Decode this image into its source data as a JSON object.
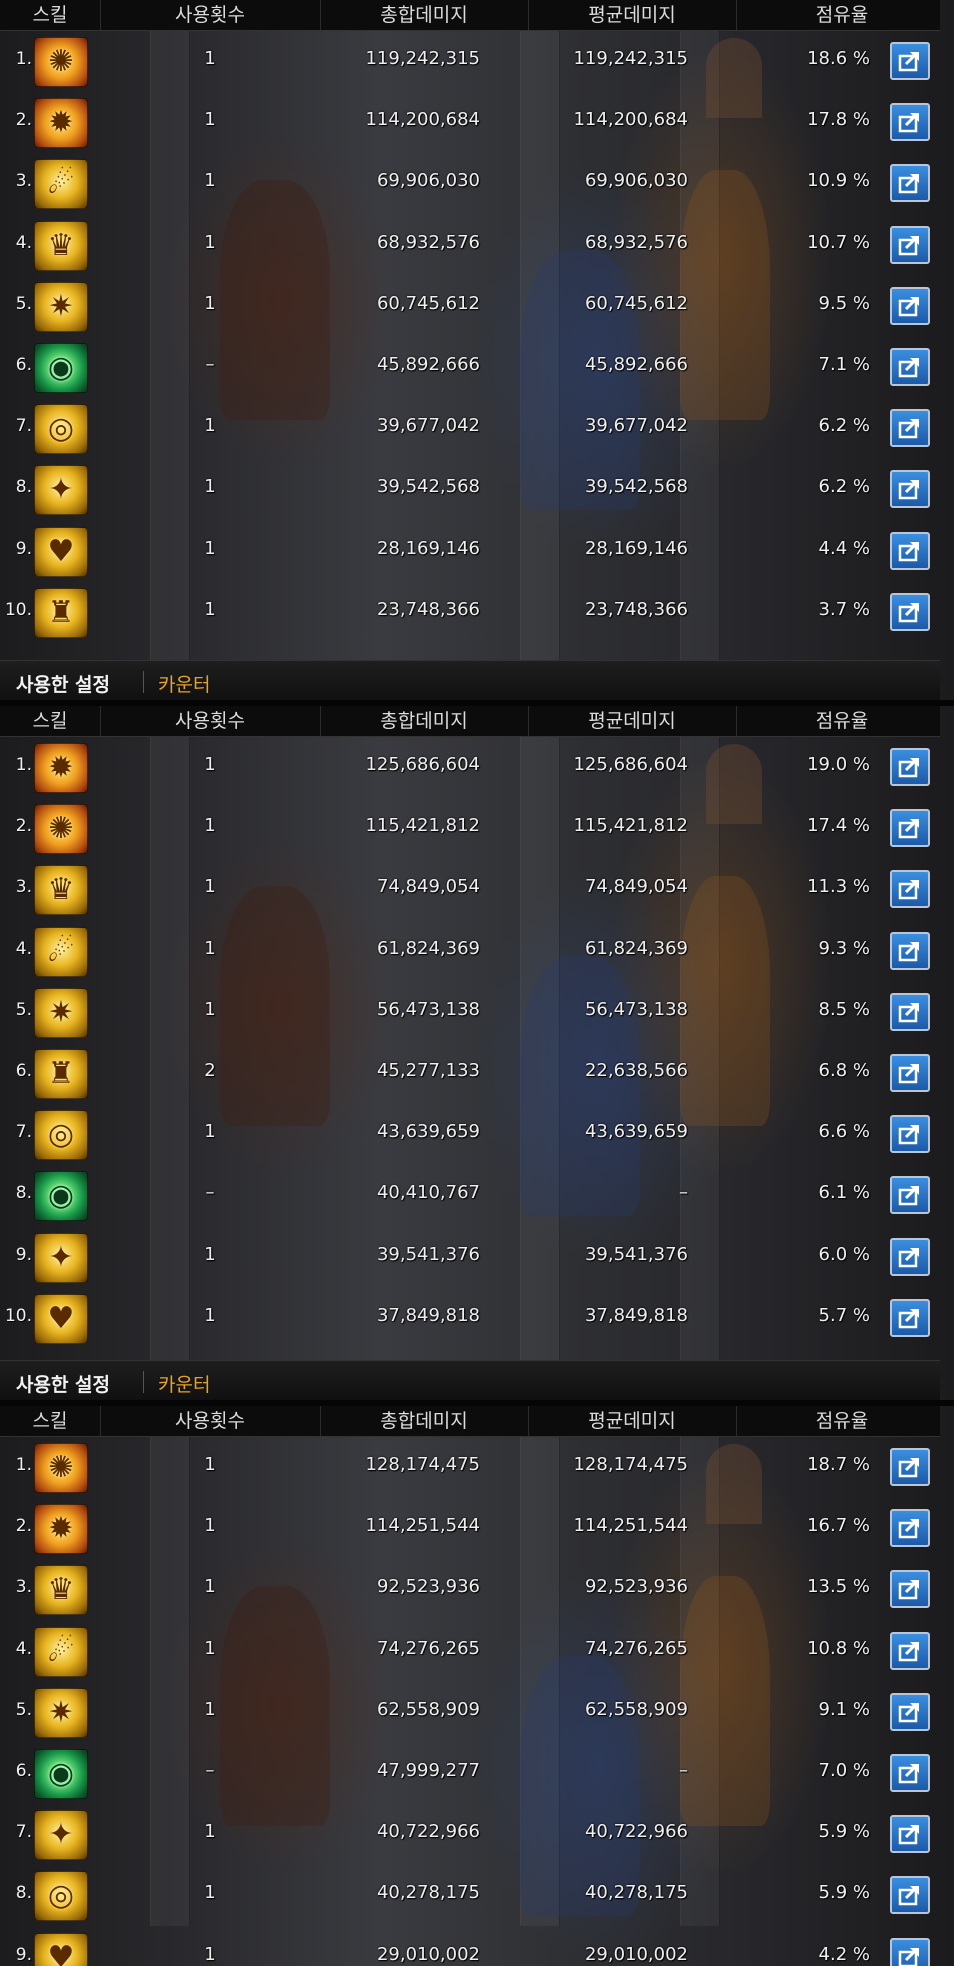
{
  "headers": {
    "skill": "스킬",
    "count": "사용횟수",
    "total": "총합데미지",
    "avg": "평균데미지",
    "share": "점유율"
  },
  "footer": {
    "used_settings": "사용한 설정",
    "counter": "카운터"
  },
  "colors": {
    "header_bg": "#0c0c0c",
    "counter_tab": "#e8a22a",
    "share_button": "#2a74c8"
  },
  "panels": [
    {
      "rows": [
        {
          "rank": "1.",
          "icon": "burst-skill-icon",
          "icon_style": "fire",
          "count": "1",
          "total": "119,242,315",
          "avg": "119,242,315",
          "share": "18.6 %"
        },
        {
          "rank": "2.",
          "icon": "flame-skill-icon",
          "icon_style": "fire",
          "count": "1",
          "total": "114,200,684",
          "avg": "114,200,684",
          "share": "17.8 %"
        },
        {
          "rank": "3.",
          "icon": "slash-skill-icon",
          "icon_style": "gold",
          "count": "1",
          "total": "69,906,030",
          "avg": "69,906,030",
          "share": "10.9 %"
        },
        {
          "rank": "4.",
          "icon": "crown-skill-icon",
          "icon_style": "gold",
          "count": "1",
          "total": "68,932,576",
          "avg": "68,932,576",
          "share": "10.7 %"
        },
        {
          "rank": "5.",
          "icon": "gear-skill-icon",
          "icon_style": "gold",
          "count": "1",
          "total": "60,745,612",
          "avg": "60,745,612",
          "share": "9.5 %"
        },
        {
          "rank": "6.",
          "icon": "eye-skill-icon",
          "icon_style": "green",
          "count": "–",
          "total": "45,892,666",
          "avg": "45,892,666",
          "share": "7.1 %"
        },
        {
          "rank": "7.",
          "icon": "ring-skill-icon",
          "icon_style": "gold",
          "count": "1",
          "total": "39,677,042",
          "avg": "39,677,042",
          "share": "6.2 %"
        },
        {
          "rank": "8.",
          "icon": "wing-skill-icon",
          "icon_style": "gold",
          "count": "1",
          "total": "39,542,568",
          "avg": "39,542,568",
          "share": "6.2 %"
        },
        {
          "rank": "9.",
          "icon": "heart-skill-icon",
          "icon_style": "gold",
          "count": "1",
          "total": "28,169,146",
          "avg": "28,169,146",
          "share": "4.4 %"
        },
        {
          "rank": "10.",
          "icon": "pillar-skill-icon",
          "icon_style": "gold",
          "count": "1",
          "total": "23,748,366",
          "avg": "23,748,366",
          "share": "3.7 %"
        }
      ]
    },
    {
      "rows": [
        {
          "rank": "1.",
          "icon": "flame-skill-icon",
          "icon_style": "fire",
          "count": "1",
          "total": "125,686,604",
          "avg": "125,686,604",
          "share": "19.0 %"
        },
        {
          "rank": "2.",
          "icon": "burst-skill-icon",
          "icon_style": "fire",
          "count": "1",
          "total": "115,421,812",
          "avg": "115,421,812",
          "share": "17.4 %"
        },
        {
          "rank": "3.",
          "icon": "crown-skill-icon",
          "icon_style": "gold",
          "count": "1",
          "total": "74,849,054",
          "avg": "74,849,054",
          "share": "11.3 %"
        },
        {
          "rank": "4.",
          "icon": "slash-skill-icon",
          "icon_style": "gold",
          "count": "1",
          "total": "61,824,369",
          "avg": "61,824,369",
          "share": "9.3 %"
        },
        {
          "rank": "5.",
          "icon": "gear-skill-icon",
          "icon_style": "gold",
          "count": "1",
          "total": "56,473,138",
          "avg": "56,473,138",
          "share": "8.5 %"
        },
        {
          "rank": "6.",
          "icon": "pillar-skill-icon",
          "icon_style": "gold",
          "count": "2",
          "total": "45,277,133",
          "avg": "22,638,566",
          "share": "6.8 %"
        },
        {
          "rank": "7.",
          "icon": "ring-skill-icon",
          "icon_style": "gold",
          "count": "1",
          "total": "43,639,659",
          "avg": "43,639,659",
          "share": "6.6 %"
        },
        {
          "rank": "8.",
          "icon": "eye-skill-icon",
          "icon_style": "green",
          "count": "–",
          "total": "40,410,767",
          "avg": "–",
          "share": "6.1 %"
        },
        {
          "rank": "9.",
          "icon": "wing-skill-icon",
          "icon_style": "gold",
          "count": "1",
          "total": "39,541,376",
          "avg": "39,541,376",
          "share": "6.0 %"
        },
        {
          "rank": "10.",
          "icon": "heart-skill-icon",
          "icon_style": "gold",
          "count": "1",
          "total": "37,849,818",
          "avg": "37,849,818",
          "share": "5.7 %"
        }
      ]
    },
    {
      "rows": [
        {
          "rank": "1.",
          "icon": "burst-skill-icon",
          "icon_style": "fire",
          "count": "1",
          "total": "128,174,475",
          "avg": "128,174,475",
          "share": "18.7 %"
        },
        {
          "rank": "2.",
          "icon": "flame-skill-icon",
          "icon_style": "fire",
          "count": "1",
          "total": "114,251,544",
          "avg": "114,251,544",
          "share": "16.7 %"
        },
        {
          "rank": "3.",
          "icon": "crown-skill-icon",
          "icon_style": "gold",
          "count": "1",
          "total": "92,523,936",
          "avg": "92,523,936",
          "share": "13.5 %"
        },
        {
          "rank": "4.",
          "icon": "slash-skill-icon",
          "icon_style": "gold",
          "count": "1",
          "total": "74,276,265",
          "avg": "74,276,265",
          "share": "10.8 %"
        },
        {
          "rank": "5.",
          "icon": "gear-skill-icon",
          "icon_style": "gold",
          "count": "1",
          "total": "62,558,909",
          "avg": "62,558,909",
          "share": "9.1 %"
        },
        {
          "rank": "6.",
          "icon": "eye-skill-icon",
          "icon_style": "green",
          "count": "–",
          "total": "47,999,277",
          "avg": "–",
          "share": "7.0 %"
        },
        {
          "rank": "7.",
          "icon": "wing-skill-icon",
          "icon_style": "gold",
          "count": "1",
          "total": "40,722,966",
          "avg": "40,722,966",
          "share": "5.9 %"
        },
        {
          "rank": "8.",
          "icon": "ring-skill-icon",
          "icon_style": "gold",
          "count": "1",
          "total": "40,278,175",
          "avg": "40,278,175",
          "share": "5.9 %"
        },
        {
          "rank": "9.",
          "icon": "heart-skill-icon",
          "icon_style": "gold",
          "count": "1",
          "total": "29,010,002",
          "avg": "29,010,002",
          "share": "4.2 %"
        }
      ]
    }
  ]
}
